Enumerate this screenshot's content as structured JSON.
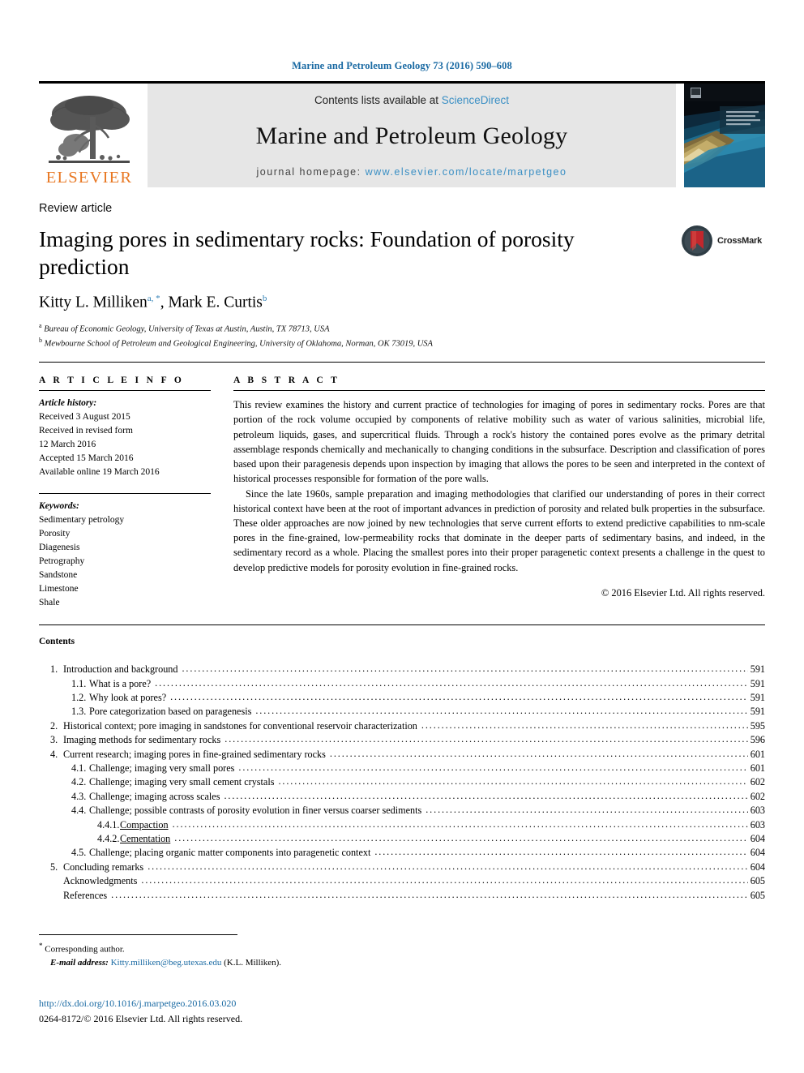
{
  "running_head": "Marine and Petroleum Geology 73 (2016) 590–608",
  "masthead": {
    "publisher_name": "ELSEVIER",
    "contents_line_prefix": "Contents lists available at ",
    "contents_line_link": "ScienceDirect",
    "journal_title": "Marine and Petroleum Geology",
    "homepage_label": "journal homepage: ",
    "homepage_url": "www.elsevier.com/locate/marpetgeo"
  },
  "article": {
    "type": "Review article",
    "title": "Imaging pores in sedimentary rocks: Foundation of porosity prediction",
    "authors": [
      {
        "name": "Kitty L. Milliken",
        "marks": "a, *"
      },
      {
        "name": "Mark E. Curtis",
        "marks": "b"
      }
    ],
    "affiliations": [
      {
        "mark": "a",
        "text": "Bureau of Economic Geology, University of Texas at Austin, Austin, TX 78713, USA"
      },
      {
        "mark": "b",
        "text": "Mewbourne School of Petroleum and Geological Engineering, University of Oklahoma, Norman, OK 73019, USA"
      }
    ],
    "crossmark_label": "CrossMark"
  },
  "article_info": {
    "heading": "A R T I C L E   I N F O",
    "history_label": "Article history:",
    "history": [
      "Received 3 August 2015",
      "Received in revised form",
      "12 March 2016",
      "Accepted 15 March 2016",
      "Available online 19 March 2016"
    ],
    "keywords_label": "Keywords:",
    "keywords": [
      "Sedimentary petrology",
      "Porosity",
      "Diagenesis",
      "Petrography",
      "Sandstone",
      "Limestone",
      "Shale"
    ]
  },
  "abstract": {
    "heading": "A B S T R A C T",
    "paragraph1": "This review examines the history and current practice of technologies for imaging of pores in sedimentary rocks. Pores are that portion of the rock volume occupied by components of relative mobility such as water of various salinities, microbial life, petroleum liquids, gases, and supercritical fluids. Through a rock's history the contained pores evolve as the primary detrital assemblage responds chemically and mechanically to changing conditions in the subsurface. Description and classification of pores based upon their paragenesis depends upon inspection by imaging that allows the pores to be seen and interpreted in the context of historical processes responsible for formation of the pore walls.",
    "paragraph2": "Since the late 1960s, sample preparation and imaging methodologies that clarified our understanding of pores in their correct historical context have been at the root of important advances in prediction of porosity and related bulk properties in the subsurface. These older approaches are now joined by new technologies that serve current efforts to extend predictive capabilities to nm-scale pores in the fine-grained, low-permeability rocks that dominate in the deeper parts of sedimentary basins, and indeed, in the sedimentary record as a whole. Placing the smallest pores into their proper paragenetic context presents a challenge in the quest to develop predictive models for porosity evolution in fine-grained rocks.",
    "copyright": "© 2016 Elsevier Ltd. All rights reserved."
  },
  "contents": {
    "heading": "Contents",
    "entries": [
      {
        "level": 1,
        "number": "1.",
        "label": "Introduction and background",
        "page": "591",
        "link": false
      },
      {
        "level": 2,
        "number": "1.1.",
        "label": "What is a pore?",
        "page": "591",
        "link": false
      },
      {
        "level": 2,
        "number": "1.2.",
        "label": "Why look at pores?",
        "page": "591",
        "link": false
      },
      {
        "level": 2,
        "number": "1.3.",
        "label": "Pore categorization based on paragenesis",
        "page": "591",
        "link": false
      },
      {
        "level": 1,
        "number": "2.",
        "label": "Historical context; pore imaging in sandstones for conventional reservoir characterization",
        "page": "595",
        "link": false
      },
      {
        "level": 1,
        "number": "3.",
        "label": "Imaging methods for sedimentary rocks",
        "page": "596",
        "link": false
      },
      {
        "level": 1,
        "number": "4.",
        "label": "Current research; imaging pores in fine-grained sedimentary rocks",
        "page": "601",
        "link": false
      },
      {
        "level": 2,
        "number": "4.1.",
        "label": "Challenge; imaging very small pores",
        "page": "601",
        "link": false
      },
      {
        "level": 2,
        "number": "4.2.",
        "label": "Challenge; imaging very small cement crystals",
        "page": "602",
        "link": false
      },
      {
        "level": 2,
        "number": "4.3.",
        "label": "Challenge; imaging across scales",
        "page": "602",
        "link": false
      },
      {
        "level": 2,
        "number": "4.4.",
        "label": "Challenge; possible contrasts of porosity evolution in finer versus coarser sediments",
        "page": "603",
        "link": false
      },
      {
        "level": 3,
        "number": "4.4.1.",
        "label": "Compaction",
        "page": "603",
        "link": true
      },
      {
        "level": 3,
        "number": "4.4.2.",
        "label": "Cementation",
        "page": "604",
        "link": true
      },
      {
        "level": 2,
        "number": "4.5.",
        "label": "Challenge; placing organic matter components into paragenetic context",
        "page": "604",
        "link": false
      },
      {
        "level": 1,
        "number": "5.",
        "label": "Concluding remarks",
        "page": "604",
        "link": false
      },
      {
        "level": 1,
        "number": "",
        "label": "Acknowledgments",
        "page": "605",
        "link": false
      },
      {
        "level": 1,
        "number": "",
        "label": "References",
        "page": "605",
        "link": false
      }
    ]
  },
  "footer": {
    "corresponding_author": "Corresponding author.",
    "email_label": "E-mail address:",
    "email": "Kitty.milliken@beg.utexas.edu",
    "email_owner": "(K.L. Milliken).",
    "doi": "http://dx.doi.org/10.1016/j.marpetgeo.2016.03.020",
    "issn_line": "0264-8172/© 2016 Elsevier Ltd. All rights reserved."
  },
  "colors": {
    "link_blue": "#1a6aa3",
    "sciencedirect_blue": "#3a8fc4",
    "elsevier_orange": "#e87722",
    "banner_grey": "#e6e6e6"
  }
}
